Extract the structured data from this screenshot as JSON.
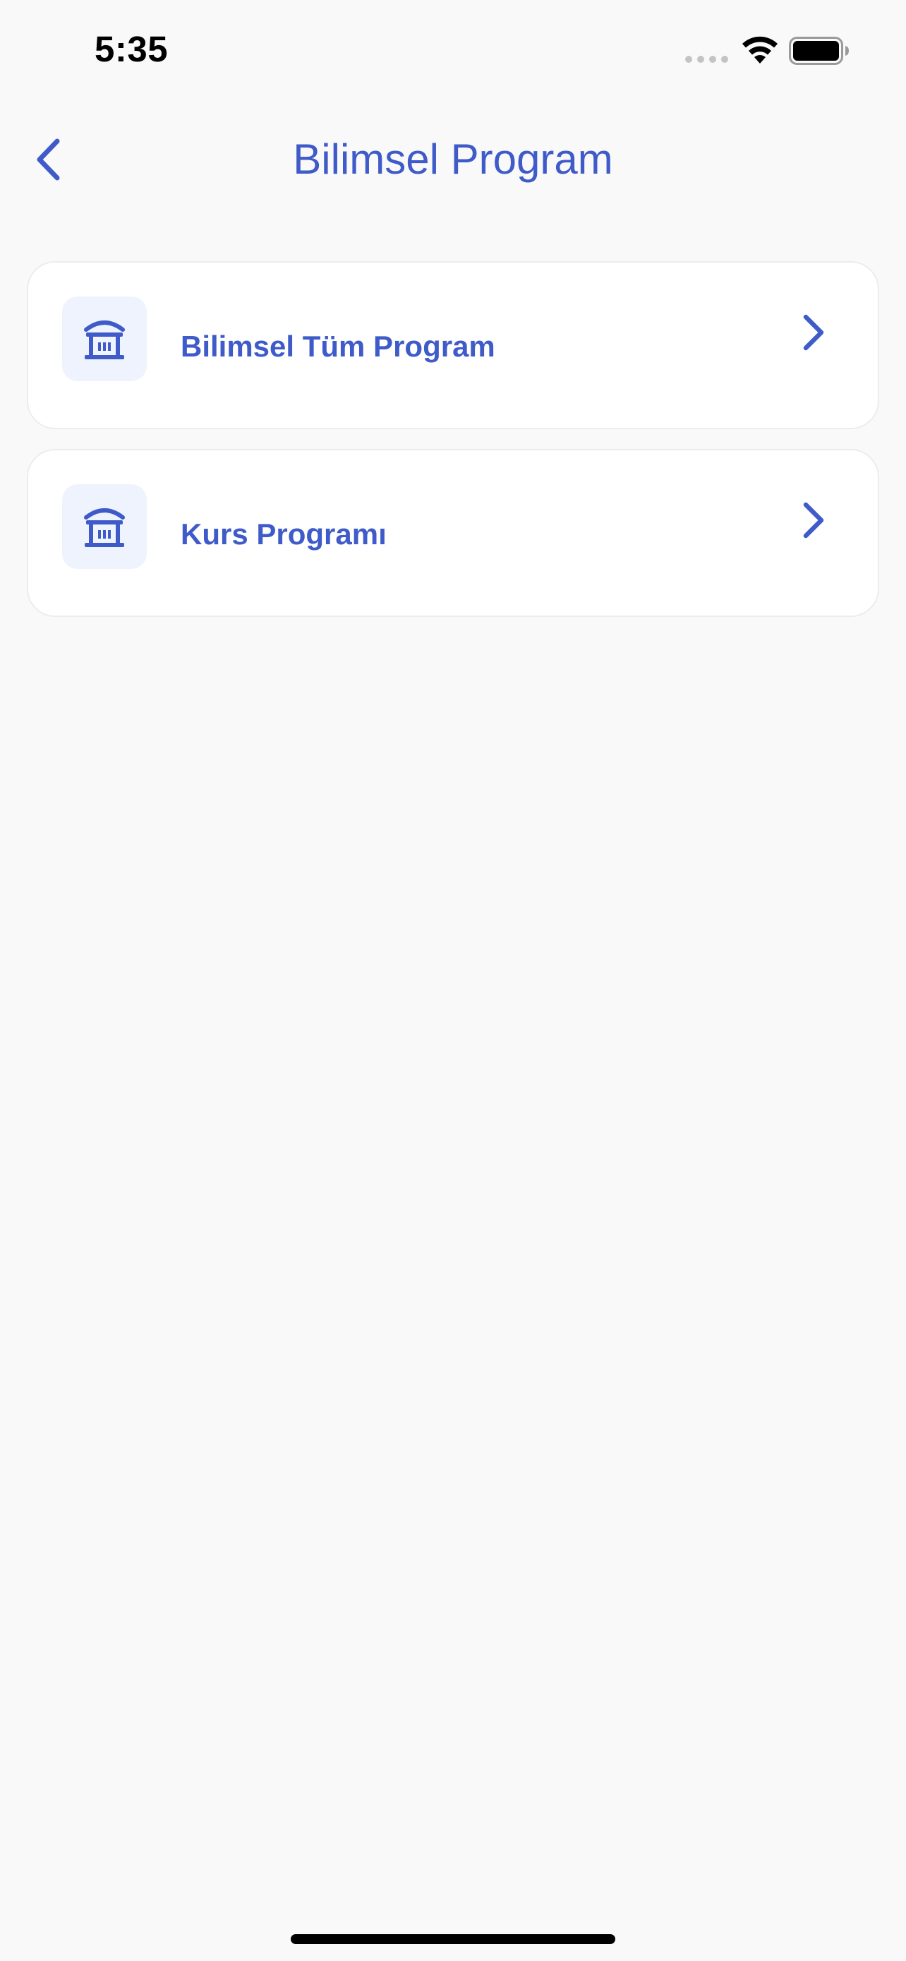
{
  "status_bar": {
    "time": "5:35"
  },
  "header": {
    "title": "Bilimsel Program",
    "back_icon": "chevron-left-icon"
  },
  "program_list": {
    "items": [
      {
        "label": "Bilimsel Tüm Program",
        "icon": "building-columns-icon"
      },
      {
        "label": "Kurs Programı",
        "icon": "building-columns-icon"
      }
    ]
  },
  "colors": {
    "accent": "#3f5bc9",
    "icon_background": "#eef3fd",
    "card_background": "#ffffff",
    "page_background": "#f9f9f9",
    "card_border": "#ececec"
  }
}
